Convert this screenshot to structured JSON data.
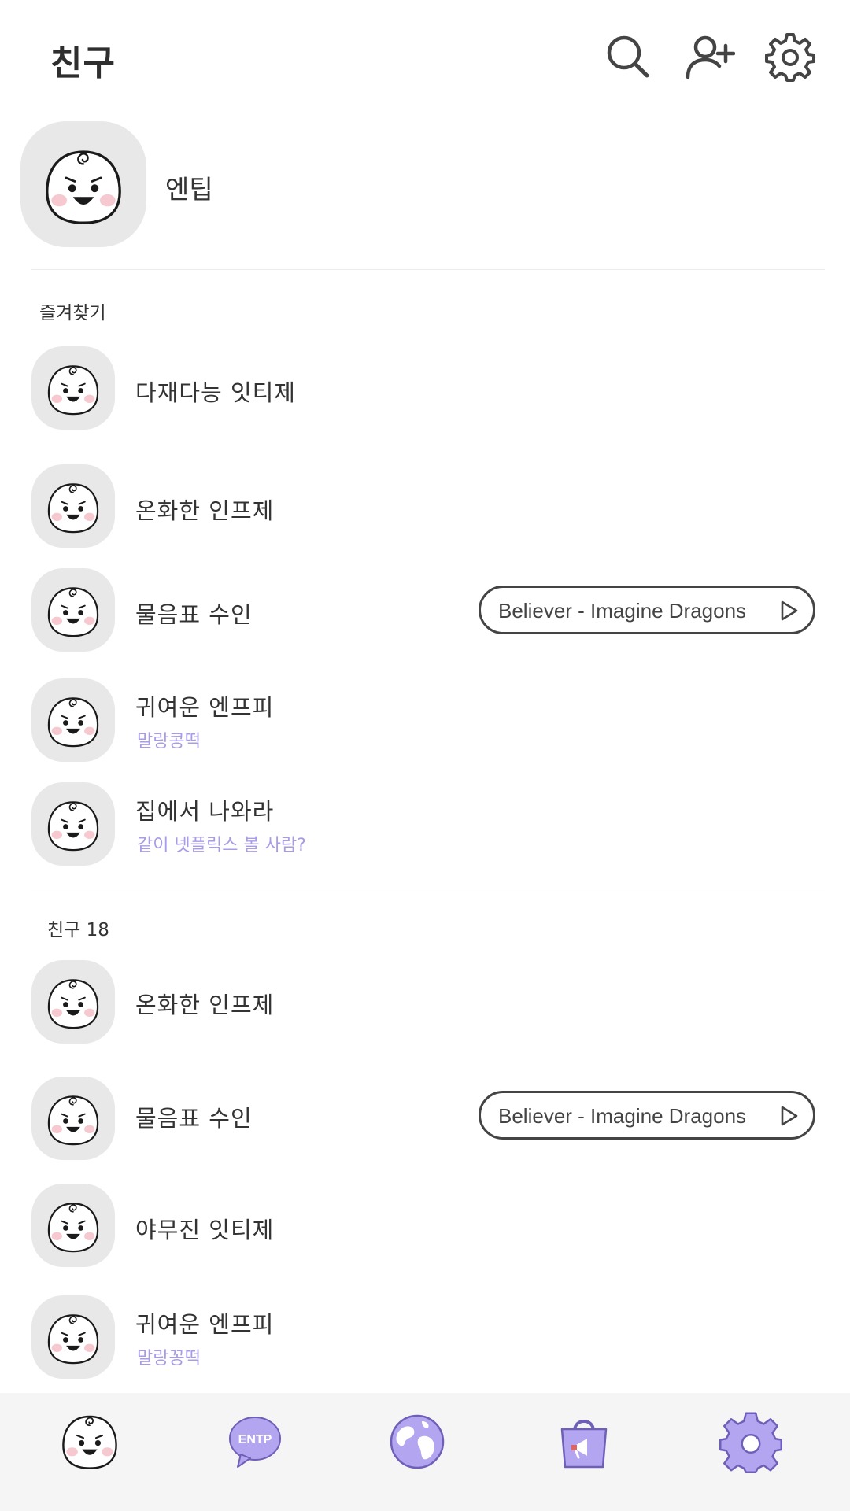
{
  "header": {
    "title": "친구",
    "icons": [
      "search-icon",
      "add-friend-icon",
      "settings-icon"
    ]
  },
  "me": {
    "name": "엔팁"
  },
  "favorites": {
    "label": "즐겨찾기",
    "items": [
      {
        "name": "다재다능 잇티제"
      },
      {
        "name": "온화한 인프제"
      },
      {
        "name": "물음표 수인",
        "music": "Believer - Imagine Dragons"
      },
      {
        "name": "귀여운 엔프피",
        "status": "말랑콩떡"
      },
      {
        "name": "집에서 나와라",
        "status": "같이 넷플릭스 볼 사람?"
      }
    ]
  },
  "friends": {
    "label": "친구 18",
    "items": [
      {
        "name": "온화한 인프제"
      },
      {
        "name": "물음표 수인",
        "music": "Believer - Imagine Dragons"
      },
      {
        "name": "야무진 잇티제"
      },
      {
        "name": "귀여운 엔프피",
        "status": "말랑꽁떡"
      }
    ]
  },
  "bottom_nav": {
    "items": [
      {
        "icon": "profile-face-icon"
      },
      {
        "icon": "entp-chat-bubble-icon",
        "badge": "ENTP"
      },
      {
        "icon": "globe-icon"
      },
      {
        "icon": "shopping-bag-icon"
      },
      {
        "icon": "settings-gear-icon"
      }
    ]
  },
  "colors": {
    "accent": "#a99ce6",
    "nav_icon_fill": "#b3a5ef",
    "avatar_bg": "#e8e8e8",
    "nav_bg": "#f5f5f5"
  }
}
